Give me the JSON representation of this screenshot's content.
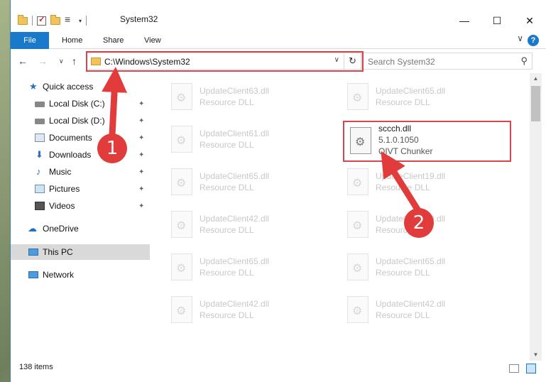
{
  "window": {
    "title": "System32",
    "buttons": {
      "minimize": "—",
      "maximize": "☐",
      "close": "✕"
    }
  },
  "ribbon": {
    "tabs": [
      "File",
      "Home",
      "Share",
      "View"
    ],
    "help": "?",
    "collapse": "∨"
  },
  "address": {
    "path": "C:\\Windows\\System32",
    "dropdown": "∨",
    "refresh": "↻",
    "search_placeholder": "Search System32"
  },
  "nav": {
    "back": "←",
    "forward": "→",
    "recent": "∨",
    "up": "↑"
  },
  "sidebar": {
    "items": [
      {
        "label": "Quick access",
        "icon": "star-icon",
        "pinned": false
      },
      {
        "label": "Local Disk (C:)",
        "icon": "disk-icon",
        "pinned": true
      },
      {
        "label": "Local Disk (D:)",
        "icon": "disk-icon",
        "pinned": true
      },
      {
        "label": "Documents",
        "icon": "documents-icon",
        "pinned": true
      },
      {
        "label": "Downloads",
        "icon": "downloads-icon",
        "pinned": true
      },
      {
        "label": "Music",
        "icon": "music-icon",
        "pinned": true
      },
      {
        "label": "Pictures",
        "icon": "pictures-icon",
        "pinned": true
      },
      {
        "label": "Videos",
        "icon": "videos-icon",
        "pinned": true
      },
      {
        "label": "OneDrive",
        "icon": "cloud-icon",
        "pinned": false
      },
      {
        "label": "This PC",
        "icon": "pc-icon",
        "pinned": false,
        "selected": true
      },
      {
        "label": "Network",
        "icon": "network-icon",
        "pinned": false
      }
    ],
    "pin_glyph": "📌"
  },
  "files": {
    "left": [
      {
        "name": "UpdateClient63.dll",
        "desc": "Resource DLL"
      },
      {
        "name": "UpdateClient61.dll",
        "desc": "Resource DLL"
      },
      {
        "name": "UpdateClient65.dll",
        "desc": "Resource DLL"
      },
      {
        "name": "UpdateClient42.dll",
        "desc": "Resource DLL"
      },
      {
        "name": "UpdateClient65.dll",
        "desc": "Resource DLL"
      },
      {
        "name": "UpdateClient42.dll",
        "desc": "Resource DLL"
      }
    ],
    "right": [
      {
        "name": "UpdateClient65.dll",
        "desc": "Resource DLL"
      },
      {
        "name": "UpdateClient19.dll",
        "desc": "Resource DLL"
      },
      {
        "name": "UpdateClient19.dll",
        "desc": "Resource DLL"
      },
      {
        "name": "UpdateClient65.dll",
        "desc": "Resource DLL"
      },
      {
        "name": "UpdateClient42.dll",
        "desc": "Resource DLL"
      }
    ],
    "highlighted": {
      "name": "sccch.dll",
      "version": "5.1.0.1050",
      "desc": "QIVT Chunker"
    }
  },
  "status": {
    "count": "138 items"
  },
  "annotations": {
    "marker1": "1",
    "marker2": "2",
    "color": "#e23b3b"
  }
}
